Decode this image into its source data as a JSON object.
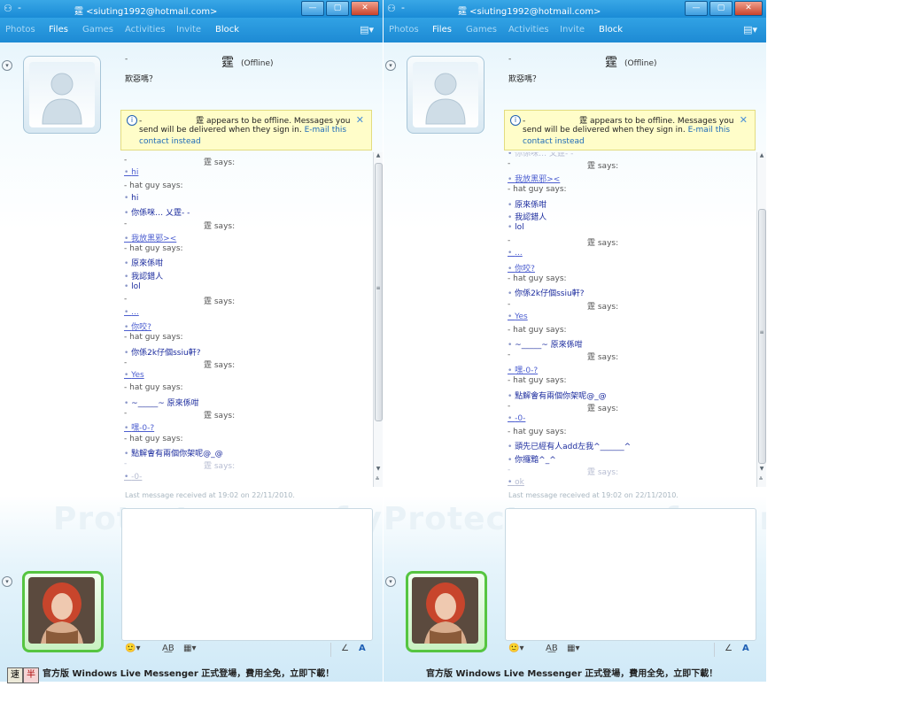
{
  "window": {
    "title": "霆 <siuting1992@hotmail.com>",
    "title_dash": "-",
    "buttons": {
      "minimize": "—",
      "maximize": "▢",
      "close": "✕"
    }
  },
  "menu": {
    "photos": "Photos",
    "files": "Files",
    "games": "Games",
    "activities": "Activities",
    "invite": "Invite",
    "block": "Block"
  },
  "contact": {
    "dash": "-",
    "name": "霆",
    "status": "(Offline)",
    "personal_message": "欺惡嗎？"
  },
  "notice": {
    "line1_dash": "-",
    "line1_name": "霆",
    "line1_text": "appears to be offline. Messages you",
    "line2_text": "send will be delivered when they sign in.",
    "line2_link": "E-mail this",
    "line3_link": "contact instead",
    "close": "✕"
  },
  "conversation_a": [
    {
      "kind": "hdr",
      "text": "-",
      "says": "霆 says:"
    },
    {
      "kind": "msg",
      "text": "hi",
      "link": true
    },
    {
      "kind": "hdr",
      "text": "- hat guy says:"
    },
    {
      "kind": "msg",
      "text": "hi"
    },
    {
      "kind": "msg",
      "text": "你係咪… 乂霆- -"
    },
    {
      "kind": "hdr",
      "text": "-",
      "says": "霆 says:"
    },
    {
      "kind": "msg",
      "text": "我放黑邪><",
      "link": true
    },
    {
      "kind": "hdr",
      "text": "- hat guy says:"
    },
    {
      "kind": "msg",
      "text": "原來係咁"
    },
    {
      "kind": "msg",
      "text": "我認錯人"
    },
    {
      "kind": "msg",
      "text": "lol"
    },
    {
      "kind": "hdr",
      "text": "-",
      "says": "霆 says:"
    },
    {
      "kind": "msg",
      "text": "...",
      "link": true
    },
    {
      "kind": "msg",
      "text": "你咬?",
      "link": true
    },
    {
      "kind": "hdr",
      "text": "- hat guy says:"
    },
    {
      "kind": "msg",
      "text": "你係2k仔個ssiu軒?"
    },
    {
      "kind": "hdr",
      "text": "-",
      "says": "霆 says:"
    },
    {
      "kind": "msg",
      "text": "Yes",
      "link": true
    },
    {
      "kind": "hdr",
      "text": "- hat guy says:"
    },
    {
      "kind": "msg",
      "text": "~_____~ 原來係咁"
    },
    {
      "kind": "hdr",
      "text": "-",
      "says": "霆 says:"
    },
    {
      "kind": "msg",
      "text": "嘿-0-?",
      "link": true
    },
    {
      "kind": "hdr",
      "text": "- hat guy says:"
    },
    {
      "kind": "msg",
      "text": "點解會有兩個你架呢@_@"
    },
    {
      "kind": "hdr",
      "text": "-",
      "says": "霆 says:",
      "faded": true
    },
    {
      "kind": "msg",
      "text": "-0-",
      "link": true,
      "faded": true
    }
  ],
  "conversation_b": [
    {
      "kind": "msg",
      "text": "你係咪… 乂霆- -",
      "faded": true
    },
    {
      "kind": "hdr",
      "text": "-",
      "says": "霆 says:"
    },
    {
      "kind": "msg",
      "text": "我放黑邪><",
      "link": true
    },
    {
      "kind": "hdr",
      "text": "- hat guy says:"
    },
    {
      "kind": "msg",
      "text": "原來係咁"
    },
    {
      "kind": "msg",
      "text": "我認錯人"
    },
    {
      "kind": "msg",
      "text": "lol"
    },
    {
      "kind": "hdr",
      "text": "-",
      "says": "霆 says:"
    },
    {
      "kind": "msg",
      "text": "...",
      "link": true
    },
    {
      "kind": "msg",
      "text": "你咬?",
      "link": true
    },
    {
      "kind": "hdr",
      "text": "- hat guy says:"
    },
    {
      "kind": "msg",
      "text": "你係2k仔個ssiu軒?"
    },
    {
      "kind": "hdr",
      "text": "-",
      "says": "霆 says:"
    },
    {
      "kind": "msg",
      "text": "Yes",
      "link": true
    },
    {
      "kind": "hdr",
      "text": "- hat guy says:"
    },
    {
      "kind": "msg",
      "text": "~_____~ 原來係咁"
    },
    {
      "kind": "hdr",
      "text": "-",
      "says": "霆 says:"
    },
    {
      "kind": "msg",
      "text": "嘿-0-?",
      "link": true
    },
    {
      "kind": "hdr",
      "text": "- hat guy says:"
    },
    {
      "kind": "msg",
      "text": "點解會有兩個你架呢@_@"
    },
    {
      "kind": "hdr",
      "text": "-",
      "says": "霆 says:"
    },
    {
      "kind": "msg",
      "text": "-0-",
      "link": true
    },
    {
      "kind": "hdr",
      "text": "- hat guy says:"
    },
    {
      "kind": "msg",
      "text": "頭先已經有人add左我^______^"
    },
    {
      "kind": "msg",
      "text": "你攞黯^_^"
    },
    {
      "kind": "hdr",
      "text": "-",
      "says": "霆 says:",
      "faded": true
    },
    {
      "kind": "msg",
      "text": "ok",
      "link": true,
      "faded": true
    }
  ],
  "last_message": "Last message received at 19:02 on 22/11/2010.",
  "watermark": "Protect more of your memories for",
  "toolbar": {
    "emoticon": "🙂▾",
    "font": "A͟B",
    "wink": "▦▾",
    "handwriting": "∠",
    "text_format": "A"
  },
  "promo": "官方版 Windows Live Messenger 正式登場，費用全免，立即下載！",
  "ime": [
    "速",
    "半"
  ]
}
